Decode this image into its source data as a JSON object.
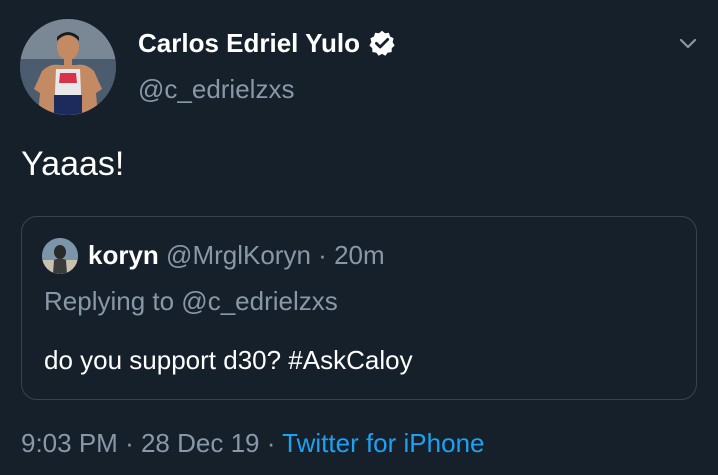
{
  "tweet": {
    "author": {
      "display_name": "Carlos Edriel Yulo",
      "handle": "@c_edrielzxs",
      "verified": true,
      "avatar_icon": "profile-photo-gymnast"
    },
    "text": "Yaaas!",
    "quoted": {
      "author_name": "koryn",
      "author_handle": "@MrglKoryn",
      "separator": "·",
      "time": "20m",
      "replying_to": "Replying to @c_edrielzxs",
      "text": "do you support d30? #AskCaloy"
    },
    "meta": {
      "time": "9:03 PM",
      "sep1": "·",
      "date": "28 Dec 19",
      "sep2": "·",
      "source": "Twitter for iPhone"
    }
  },
  "colors": {
    "background": "#15202b",
    "primary_text": "#ffffff",
    "secondary_text": "#8899a6",
    "link": "#1da1f2",
    "border": "#38444d"
  },
  "icons": {
    "verified": "verified-badge-icon",
    "caret": "chevron-down-icon"
  }
}
